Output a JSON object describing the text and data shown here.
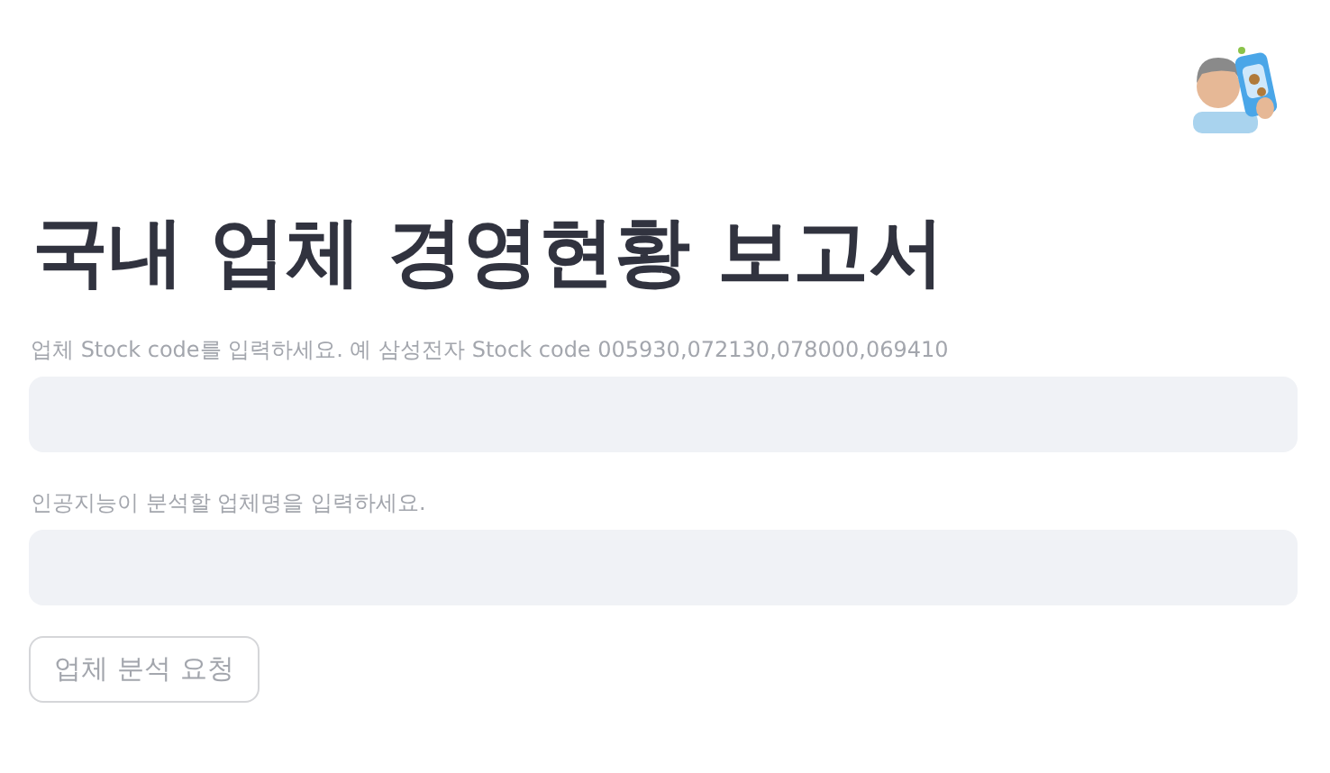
{
  "title": "국내 업체 경영현황 보고서",
  "fields": [
    {
      "label": "업체 Stock code를 입력하세요. 예 삼성전자 Stock code 005930,072130,078000,069410",
      "disabled": true
    },
    {
      "label": "인공지능이 분석할 업체명을 입력하세요.",
      "disabled": true
    }
  ],
  "button": {
    "label": "업체 분석 요청",
    "disabled": true
  }
}
